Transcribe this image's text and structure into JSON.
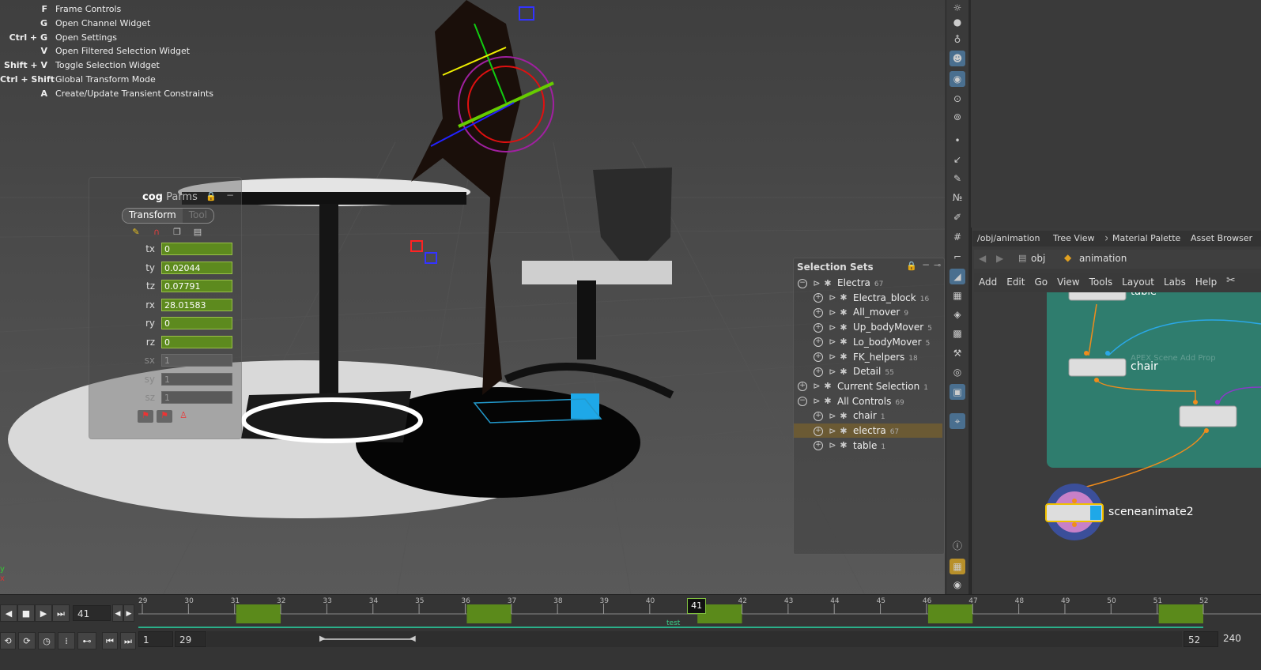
{
  "hotkeys": [
    {
      "key": "F",
      "desc": "Frame Controls"
    },
    {
      "key": "G",
      "desc": "Open Channel Widget"
    },
    {
      "key": "Ctrl + G",
      "desc": "Open Settings"
    },
    {
      "key": "V",
      "desc": "Open Filtered Selection Widget"
    },
    {
      "key": "Shift + V",
      "desc": "Toggle Selection Widget"
    },
    {
      "key": "Ctrl + Shift",
      "desc": "Global Transform Mode"
    },
    {
      "key": "A",
      "desc": "Create/Update Transient Constraints"
    }
  ],
  "cog": {
    "title_bold": "cog",
    "title_rest": "Parms",
    "tab_transform": "Transform",
    "tab_tool": "Tool",
    "params": [
      {
        "label": "tx",
        "value": "0",
        "enabled": true
      },
      {
        "label": "ty",
        "value": "0.02044",
        "enabled": true
      },
      {
        "label": "tz",
        "value": "0.07791",
        "enabled": true
      },
      {
        "label": "rx",
        "value": "28.01583",
        "enabled": true
      },
      {
        "label": "ry",
        "value": "0",
        "enabled": true
      },
      {
        "label": "rz",
        "value": "0",
        "enabled": true
      },
      {
        "label": "sx",
        "value": "1",
        "enabled": false
      },
      {
        "label": "sy",
        "value": "1",
        "enabled": false
      },
      {
        "label": "sz",
        "value": "1",
        "enabled": false
      }
    ]
  },
  "selection_sets": {
    "title": "Selection Sets",
    "rows": [
      {
        "name": "Electra",
        "count": "67",
        "indent": 0,
        "expander": "−"
      },
      {
        "name": "Electra_block",
        "count": "16",
        "indent": 1,
        "expander": "+"
      },
      {
        "name": "All_mover",
        "count": "9",
        "indent": 1,
        "expander": "+"
      },
      {
        "name": "Up_bodyMover",
        "count": "5",
        "indent": 1,
        "expander": "+"
      },
      {
        "name": "Lo_bodyMover",
        "count": "5",
        "indent": 1,
        "expander": "+"
      },
      {
        "name": "FK_helpers",
        "count": "18",
        "indent": 1,
        "expander": "+"
      },
      {
        "name": "Detail",
        "count": "55",
        "indent": 1,
        "expander": "+"
      },
      {
        "name": "Current Selection",
        "count": "1",
        "indent": 0,
        "expander": "+"
      },
      {
        "name": "All Controls",
        "count": "69",
        "indent": 0,
        "expander": "−"
      },
      {
        "name": "chair",
        "count": "1",
        "indent": 1,
        "expander": "+"
      },
      {
        "name": "electra",
        "count": "67",
        "indent": 1,
        "expander": "+",
        "selected": true
      },
      {
        "name": "table",
        "count": "1",
        "indent": 1,
        "expander": "+"
      }
    ]
  },
  "network": {
    "tabs": [
      "/obj/animation",
      "Tree View",
      "Material Palette",
      "Asset Browser"
    ],
    "path": [
      "obj",
      "animation"
    ],
    "menu": [
      "Add",
      "Edit",
      "Go",
      "View",
      "Tools",
      "Layout",
      "Labs",
      "Help"
    ],
    "nodes": {
      "table": "table",
      "chair": "chair",
      "chair_comment": "APEX Scene Add Prop",
      "sceneanimate": "sceneanimate2"
    }
  },
  "timeline": {
    "current_frame": "41",
    "frame_marker": "41",
    "start": "1",
    "range_start": "29",
    "range_end": "52",
    "end": "240",
    "label": "test",
    "ticks": [
      {
        "n": "29",
        "f": 29
      },
      {
        "n": "30",
        "f": 30
      },
      {
        "n": "31",
        "f": 31
      },
      {
        "n": "32",
        "f": 32
      },
      {
        "n": "33",
        "f": 33
      },
      {
        "n": "34",
        "f": 34
      },
      {
        "n": "35",
        "f": 35
      },
      {
        "n": "36",
        "f": 36
      },
      {
        "n": "37",
        "f": 37
      },
      {
        "n": "38",
        "f": 38
      },
      {
        "n": "39",
        "f": 39
      },
      {
        "n": "40",
        "f": 40
      },
      {
        "n": "42",
        "f": 42
      },
      {
        "n": "43",
        "f": 43
      },
      {
        "n": "44",
        "f": 44
      },
      {
        "n": "45",
        "f": 45
      },
      {
        "n": "46",
        "f": 46
      },
      {
        "n": "47",
        "f": 47
      },
      {
        "n": "48",
        "f": 48
      },
      {
        "n": "49",
        "f": 49
      },
      {
        "n": "50",
        "f": 50
      },
      {
        "n": "51",
        "f": 51
      },
      {
        "n": "52",
        "f": 52
      }
    ],
    "keyframes": [
      31,
      36,
      41,
      46,
      51
    ]
  },
  "axis": {
    "y": "y",
    "x": "x"
  }
}
